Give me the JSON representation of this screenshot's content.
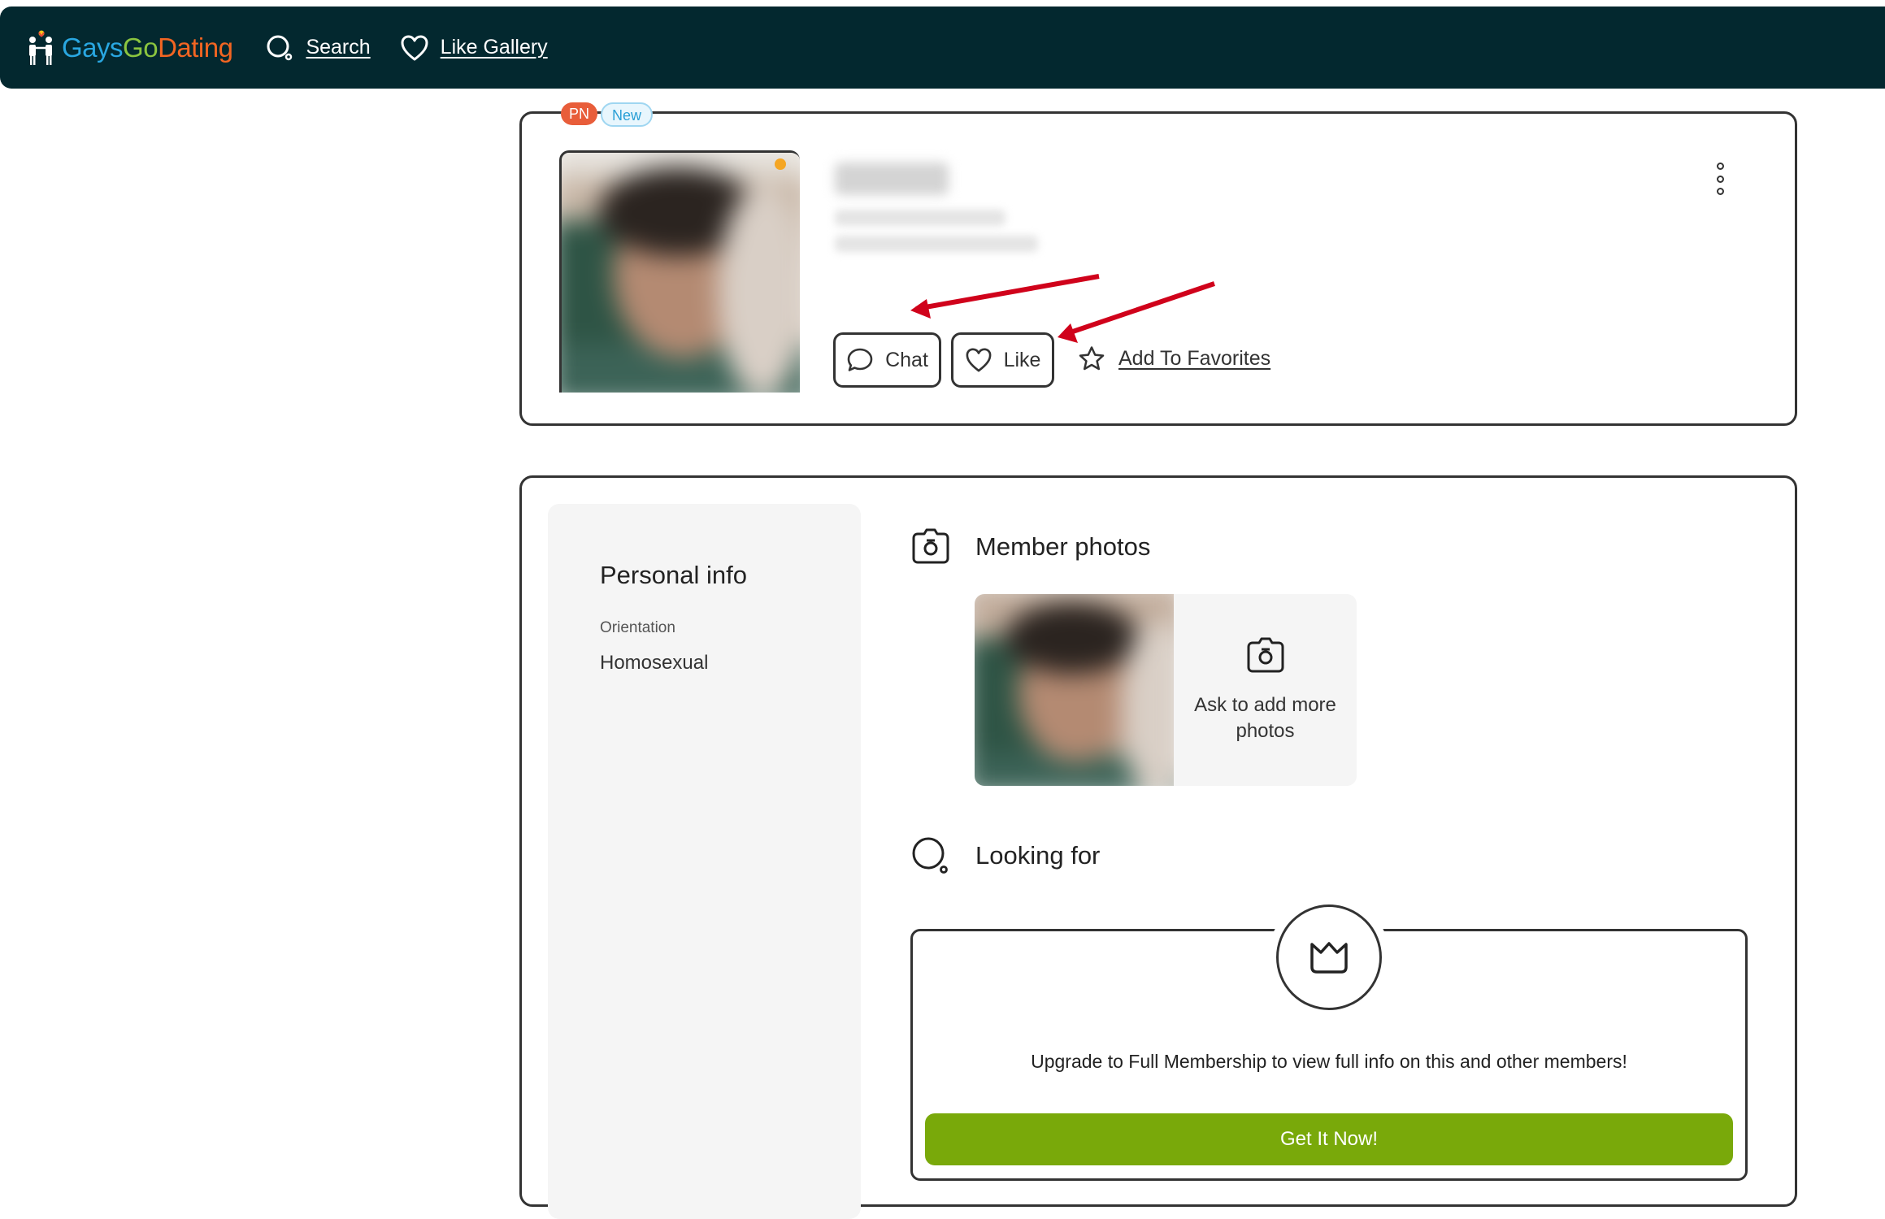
{
  "nav": {
    "logo": {
      "part1": "Gays",
      "part2": "Go",
      "part3": "Dating"
    },
    "search_label": "Search",
    "like_gallery_label": "Like Gallery"
  },
  "profile": {
    "badges": {
      "pn": "PN",
      "new": "New"
    },
    "chat_label": "Chat",
    "like_label": "Like",
    "favorites_label": "Add To Favorites"
  },
  "details": {
    "personal_info_title": "Personal info",
    "orientation_label": "Orientation",
    "orientation_value": "Homosexual",
    "member_photos_title": "Member photos",
    "ask_more_photos": "Ask to add more photos",
    "looking_for_title": "Looking for",
    "upgrade_text": "Upgrade to Full Membership to view full info on this and other members!",
    "cta_label": "Get It Now!"
  },
  "colors": {
    "nav_bg": "#03282f",
    "logo_blue": "#29a7e1",
    "logo_green": "#8bc53f",
    "logo_orange": "#f26522",
    "badge_pn": "#e85d3a",
    "badge_new": "#2a9fd6",
    "cta_green": "#79a90a",
    "annotation_arrow": "#d0021b"
  },
  "icons": [
    "logo-figures-icon",
    "search-icon",
    "heart-icon",
    "chat-bubble-icon",
    "star-icon",
    "kebab-menu-icon",
    "camera-icon",
    "crown-icon"
  ]
}
